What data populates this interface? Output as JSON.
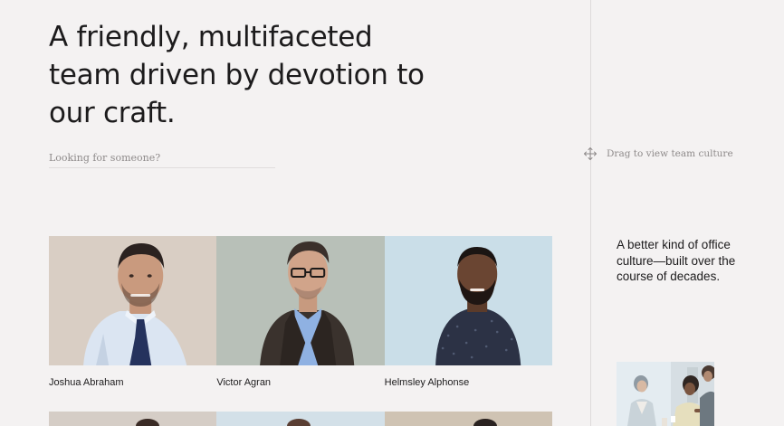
{
  "hero": {
    "title": "A friendly, multifaceted team driven by devotion to our craft."
  },
  "search": {
    "placeholder": "Looking for someone?"
  },
  "drag_hint": {
    "label": "Drag to view team culture",
    "icon": "move-arrows-icon"
  },
  "culture": {
    "text": "A better kind of office culture—built over the course of decades."
  },
  "team": {
    "members": [
      {
        "name": "Joshua Abraham"
      },
      {
        "name": "Victor Agran"
      },
      {
        "name": "Helmsley Alphonse"
      }
    ]
  },
  "colors": {
    "background": "#f4f2f2",
    "text": "#1c1b1c",
    "muted": "#8e8a8a"
  }
}
